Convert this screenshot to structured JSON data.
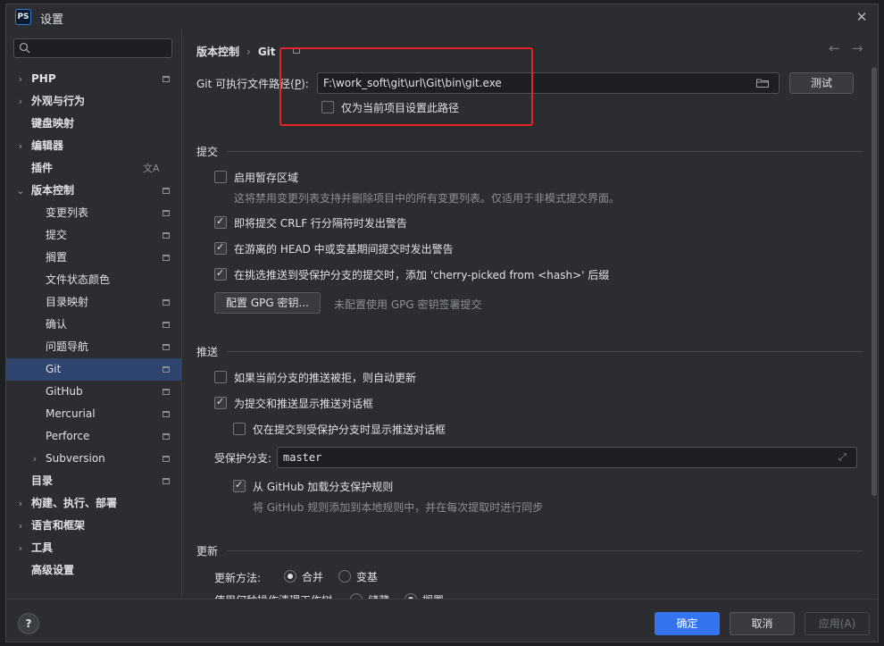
{
  "window": {
    "title": "设置",
    "app_logo": "PS"
  },
  "search": {
    "placeholder": ""
  },
  "sidebar": {
    "items": [
      {
        "label": "PHP",
        "level": 0,
        "arrow": "›",
        "project_icon": true,
        "bold": true
      },
      {
        "label": "外观与行为",
        "level": 0,
        "arrow": "›",
        "project_icon": false,
        "bold": true
      },
      {
        "label": "键盘映射",
        "level": 0,
        "arrow": "",
        "project_icon": false,
        "bold": true
      },
      {
        "label": "编辑器",
        "level": 0,
        "arrow": "›",
        "project_icon": false,
        "bold": true
      },
      {
        "label": "插件",
        "level": 0,
        "arrow": "",
        "project_icon": false,
        "bold": true,
        "translate_icon": true
      },
      {
        "label": "版本控制",
        "level": 0,
        "arrow": "⌄",
        "project_icon": true,
        "bold": true
      },
      {
        "label": "变更列表",
        "level": 1,
        "arrow": "",
        "project_icon": true
      },
      {
        "label": "提交",
        "level": 1,
        "arrow": "",
        "project_icon": true
      },
      {
        "label": "搁置",
        "level": 1,
        "arrow": "",
        "project_icon": true
      },
      {
        "label": "文件状态颜色",
        "level": 1,
        "arrow": "",
        "project_icon": false
      },
      {
        "label": "目录映射",
        "level": 1,
        "arrow": "",
        "project_icon": true
      },
      {
        "label": "确认",
        "level": 1,
        "arrow": "",
        "project_icon": true
      },
      {
        "label": "问题导航",
        "level": 1,
        "arrow": "",
        "project_icon": true
      },
      {
        "label": "Git",
        "level": 1,
        "arrow": "",
        "project_icon": true,
        "selected": true
      },
      {
        "label": "GitHub",
        "level": 1,
        "arrow": "",
        "project_icon": true
      },
      {
        "label": "Mercurial",
        "level": 1,
        "arrow": "",
        "project_icon": true
      },
      {
        "label": "Perforce",
        "level": 1,
        "arrow": "",
        "project_icon": true
      },
      {
        "label": "Subversion",
        "level": 1,
        "arrow": "›",
        "project_icon": true
      },
      {
        "label": "目录",
        "level": 0,
        "arrow": "",
        "project_icon": true,
        "bold": true
      },
      {
        "label": "构建、执行、部署",
        "level": 0,
        "arrow": "›",
        "project_icon": false,
        "bold": true
      },
      {
        "label": "语言和框架",
        "level": 0,
        "arrow": "›",
        "project_icon": false,
        "bold": true
      },
      {
        "label": "工具",
        "level": 0,
        "arrow": "›",
        "project_icon": false,
        "bold": true
      },
      {
        "label": "高级设置",
        "level": 0,
        "arrow": "",
        "project_icon": false,
        "bold": true
      }
    ]
  },
  "breadcrumb": {
    "parent": "版本控制",
    "separator": "›",
    "current": "Git"
  },
  "git": {
    "exe_label_prefix": "Git 可执行文件路径(",
    "exe_label_mnemonic": "P",
    "exe_label_suffix": "):",
    "exe_path": "F:\\work_soft\\git\\url\\Git\\bin\\git.exe",
    "test_button": "测试",
    "project_only": "仅为当前项目设置此路径"
  },
  "commit": {
    "section": "提交",
    "staging": "启用暂存区域",
    "staging_hint": "这将禁用变更列表支持并删除项目中的所有变更列表。仅适用于非模式提交界面。",
    "crlf": "即将提交 CRLF 行分隔符时发出警告",
    "detached": "在游离的 HEAD 中或变基期间提交时发出警告",
    "cherry": "在挑选推送到受保护分支的提交时，添加 'cherry-picked from <hash>' 后缀",
    "gpg_button": "配置 GPG 密钥...",
    "gpg_hint": "未配置使用 GPG 密钥签署提交"
  },
  "push": {
    "section": "推送",
    "auto_update": "如果当前分支的推送被拒，则自动更新",
    "show_dialog": "为提交和推送显示推送对话框",
    "protected_only": "仅在提交到受保护分支时显示推送对话框",
    "protected_label": "受保护分支:",
    "protected_value": "master",
    "github_rules": "从 GitHub 加载分支保护规则",
    "github_hint": "将 GitHub 规则添加到本地规则中，并在每次提取时进行同步"
  },
  "update": {
    "section": "更新",
    "method_label": "更新方法:",
    "merge": "合并",
    "rebase": "变基",
    "clean_label": "使用何种操作清理工作树",
    "stash": "储藏",
    "shelve": "搁置"
  },
  "footer": {
    "ok": "确定",
    "cancel": "取消",
    "apply": "应用(A)",
    "help": "?"
  }
}
